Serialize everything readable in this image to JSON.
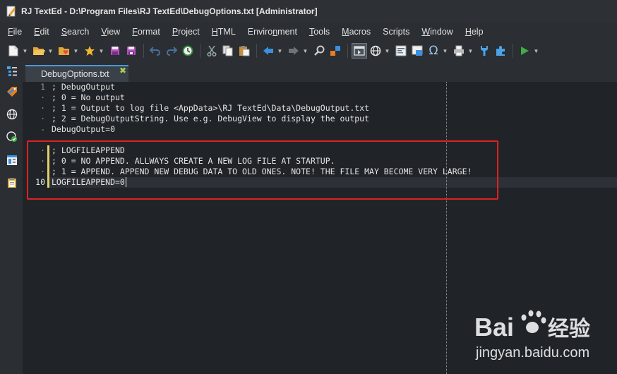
{
  "window": {
    "title": "RJ TextEd - D:\\Program Files\\RJ TextEd\\DebugOptions.txt [Administrator]"
  },
  "menu": [
    {
      "label": "File",
      "mnemonic": "F",
      "rest": "ile"
    },
    {
      "label": "Edit",
      "mnemonic": "E",
      "rest": "dit"
    },
    {
      "label": "Search",
      "mnemonic": "S",
      "rest": "earch"
    },
    {
      "label": "View",
      "mnemonic": "V",
      "rest": "iew"
    },
    {
      "label": "Format",
      "mnemonic": "F",
      "rest": "ormat"
    },
    {
      "label": "Project",
      "mnemonic": "P",
      "rest": "roject"
    },
    {
      "label": "HTML",
      "mnemonic": "H",
      "rest": "TML"
    },
    {
      "label": "Environment",
      "pre": "Enviro",
      "mnemonic": "n",
      "rest": "ment"
    },
    {
      "label": "Tools",
      "mnemonic": "T",
      "rest": "ools"
    },
    {
      "label": "Macros",
      "mnemonic": "M",
      "rest": "acros"
    },
    {
      "label": "Scripts",
      "mnemonic": "",
      "rest": "Scripts"
    },
    {
      "label": "Window",
      "mnemonic": "W",
      "rest": "indow"
    },
    {
      "label": "Help",
      "mnemonic": "H",
      "rest": "elp"
    }
  ],
  "toolbar": {
    "icons": [
      "new-file-icon",
      "open-folder-icon",
      "favorites-icon",
      "star-icon",
      "save-icon",
      "save-all-icon",
      "undo-icon",
      "redo-icon",
      "history-icon",
      "cut-icon",
      "copy-icon",
      "paste-icon",
      "back-arrow-icon",
      "forward-arrow-icon",
      "find-icon",
      "replace-icon",
      "preview-icon",
      "browser-icon",
      "file-compare-icon",
      "clip-icon",
      "omega-icon",
      "print-icon",
      "tools-icon",
      "plugin-icon",
      "run-icon"
    ]
  },
  "sidebar": {
    "icons": [
      "document-list-icon",
      "tags-icon",
      "globe-icon",
      "validate-icon",
      "explorer-icon",
      "clipboard-icon"
    ]
  },
  "tab": {
    "label": "DebugOptions.txt",
    "close_symbol": "✖"
  },
  "editor": {
    "line_numbers": [
      "1",
      "·",
      "·",
      "·",
      "-",
      "",
      "·",
      "·",
      "·",
      "10"
    ],
    "lines": [
      "; DebugOutput",
      "; 0 = No output",
      "; 1 = Output to log file <AppData>\\RJ TextEd\\Data\\DebugOutput.txt",
      "; 2 = DebugOutputString. Use e.g. DebugView to display the output",
      "DebugOutput=0",
      "",
      "; LOGFILEAPPEND",
      "; 0 = NO APPEND. ALLWAYS CREATE A NEW LOG FILE AT STARTUP.",
      "; 1 = APPEND. APPEND NEW DEBUG DATA TO OLD ONES. NOTE! THE FILE MAY BECOME VERY LARGE!",
      "LOGFILEAPPEND=0"
    ]
  },
  "watermark": {
    "brand_left": "Bai",
    "brand_right": "经验",
    "url": "jingyan.baidu.com"
  },
  "colors": {
    "accent_tab": "#4e98d8",
    "annotation_box": "#e02020",
    "modified_marker": "#e3cf68"
  }
}
